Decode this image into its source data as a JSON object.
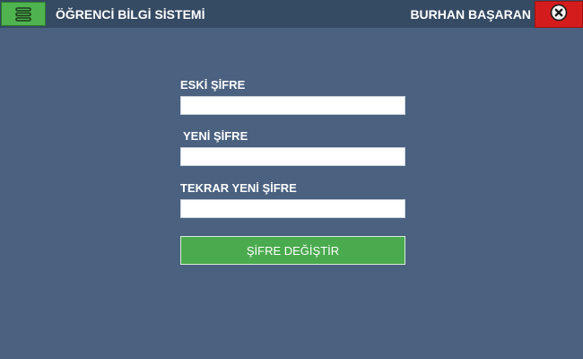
{
  "header": {
    "title": "ÖĞRENCİ BİLGİ SİSTEMİ",
    "user": "BURHAN BAŞARAN",
    "menu_icon": "hamburger-menu-icon",
    "close_icon": "close-circle-icon"
  },
  "form": {
    "old_password_label": "ESKİ ŞİFRE",
    "old_password_value": "",
    "new_password_label": "YENİ ŞİFRE",
    "new_password_value": "",
    "repeat_password_label": "TEKRAR YENİ ŞİFRE",
    "repeat_password_value": "",
    "submit_label": "ŞİFRE DEĞİŞTİR"
  },
  "colors": {
    "background": "#4a6180",
    "titlebar": "#354a63",
    "menu_button": "#4fb34f",
    "close_button": "#d41c1c",
    "submit_button": "#4aaa4e"
  }
}
